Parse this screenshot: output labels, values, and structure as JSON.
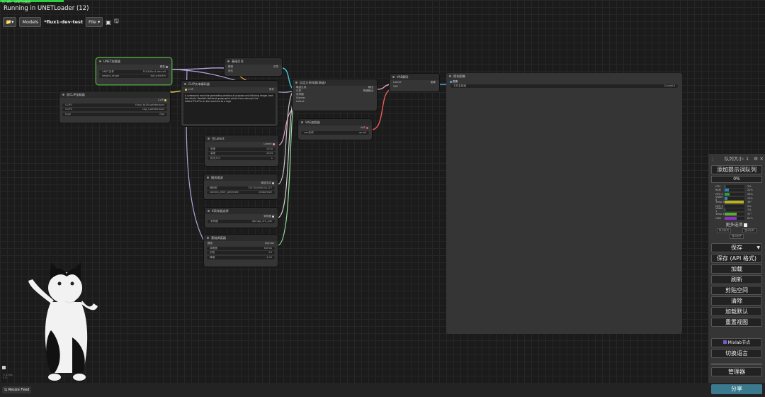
{
  "status": {
    "top_small": "[1] 8% - UNET加载器",
    "running": "Running in UNETLoader (12)"
  },
  "toolbar": {
    "folder_icon": "folder-icon",
    "models": "Models",
    "workflow_name": "*flux1-dev-test",
    "file": "File",
    "image_icon": "image-icon",
    "save_icon": "save-icon"
  },
  "nodes": {
    "unet": {
      "title": "UNET加载器",
      "output": "模型",
      "w1_label": "UNET名称",
      "w1_value": "FLUX\\flux1-dev.sft",
      "w2_label": "weight_dtype",
      "w2_value": "fp8_e4m3fn"
    },
    "guide": {
      "title": "基础引导",
      "in1": "模型",
      "in2": "条件",
      "out": "引导"
    },
    "dualclip": {
      "title": "双CLIP加载器",
      "output": "CLIP",
      "w1_label": "CLIP1",
      "w1_value": "t5xxl_fp16.safetensors",
      "w2_label": "CLIP2",
      "w2_value": "clip_l.safetensors",
      "w3_label": "type",
      "w3_value": "flux"
    },
    "cliptext": {
      "title": "CLIP文本编码器",
      "input": "CLIP",
      "output": "条件",
      "text": "A cyberpunk machine generating endless of purpose and blinking image. text the whole. Realistic National geographic photo from afar.epic.the letters\"FLUX\"is on the machine as a logo"
    },
    "sampler_custom": {
      "title": "自定义采样器(高级)",
      "in1": "噪波生成",
      "in2": "引导",
      "in3": "采样器",
      "in4": "Sigmas",
      "in5": "Latent",
      "out1": "输出",
      "out2": "降噪输出"
    },
    "vaedecode": {
      "title": "VAE解码",
      "in1": "Latent",
      "in2": "VAE",
      "out": "图像"
    },
    "vaeload": {
      "title": "VAE加载器",
      "out": "VAE",
      "w1_label": "vae名称",
      "w1_value": "ae.sft"
    },
    "empty_latent": {
      "title": "空Latent",
      "out": "Latent",
      "w1_label": "宽度",
      "w1_value": "1024",
      "w2_label": "高度",
      "w2_value": "1024",
      "w3_label": "批次大小",
      "w3_value": "1"
    },
    "noise": {
      "title": "随机噪波",
      "out": "噪波生成",
      "w1_label": "随机种",
      "w1_value": "725702850041177",
      "w2_label": "control_after_generate",
      "w2_value": "randomize"
    },
    "ksampler_select": {
      "title": "K采样器选择",
      "out": "采样器",
      "w1_label": "采样器",
      "w1_value": "dpmpp_2m_sde"
    },
    "scheduler": {
      "title": "基础调度器",
      "in1": "模型",
      "out": "Sigmas",
      "w1_label": "调度器",
      "w1_value": "karras",
      "w2_label": "步数",
      "w2_value": "20",
      "w3_label": "降噪",
      "w3_value": "1.00"
    },
    "save_image": {
      "title": "保存图像",
      "in1": "图像",
      "w1_label": "文件名前缀",
      "w1_value": "ComfyUI"
    }
  },
  "queue_panel": {
    "title": "队列大小: 1",
    "gear_icon": "gear-icon",
    "close_icon": "close-icon",
    "add_queue": "添加提示词队列",
    "progress": "0%",
    "meters": [
      {
        "label": "CPU",
        "value": "3%",
        "fill": 0.03,
        "color": "#2e9e2e"
      },
      {
        "label": "RAM",
        "value": "22%",
        "fill": 0.22,
        "color": "#2e7ec8"
      },
      {
        "label": "GPU 0",
        "value": "26%",
        "fill": 0.26,
        "color": "#2e9e2e"
      },
      {
        "label": "VRAM 0",
        "value": "13%",
        "fill": 0.13,
        "color": "#2e7ec8"
      },
      {
        "label": "Temp 0",
        "value": "38°",
        "fill": 0.95,
        "color": "#b9b21e"
      },
      {
        "label": "GPU 1",
        "value": "0%",
        "fill": 0.0,
        "color": "#2e9e2e"
      },
      {
        "label": "VRAM 1",
        "value": "1%",
        "fill": 0.01,
        "color": "#2e7ec8"
      },
      {
        "label": "Temp 1",
        "value": "37°",
        "fill": 0.6,
        "color": "#5aae2e"
      },
      {
        "label": "HDD",
        "value": "61%",
        "fill": 0.61,
        "color": "#8e2ec8"
      }
    ],
    "more_options": "更多选项",
    "small_btns": [
      "执行队列",
      "显示队列"
    ],
    "view_history": "显示历史",
    "save": "保存",
    "save_api": "保存 (API 格式)",
    "load": "加载",
    "refresh": "刷新",
    "clipspace": "剪贴空间",
    "clear": "清除",
    "load_default": "加载默认",
    "reset_view": "重置视图",
    "mixlab": "Mixlab节点",
    "switch_lang": "切换语言",
    "manager": "管理器",
    "share": "分享"
  },
  "bottom": {
    "resize_feed": "Resize Feed",
    "fps": "T: 0.00s",
    "fps2": "I: 0"
  },
  "colors": {
    "selected_border": "#4c9a3c",
    "progress_green": "#2ecc40",
    "share_btn": "#3b7a8e"
  }
}
